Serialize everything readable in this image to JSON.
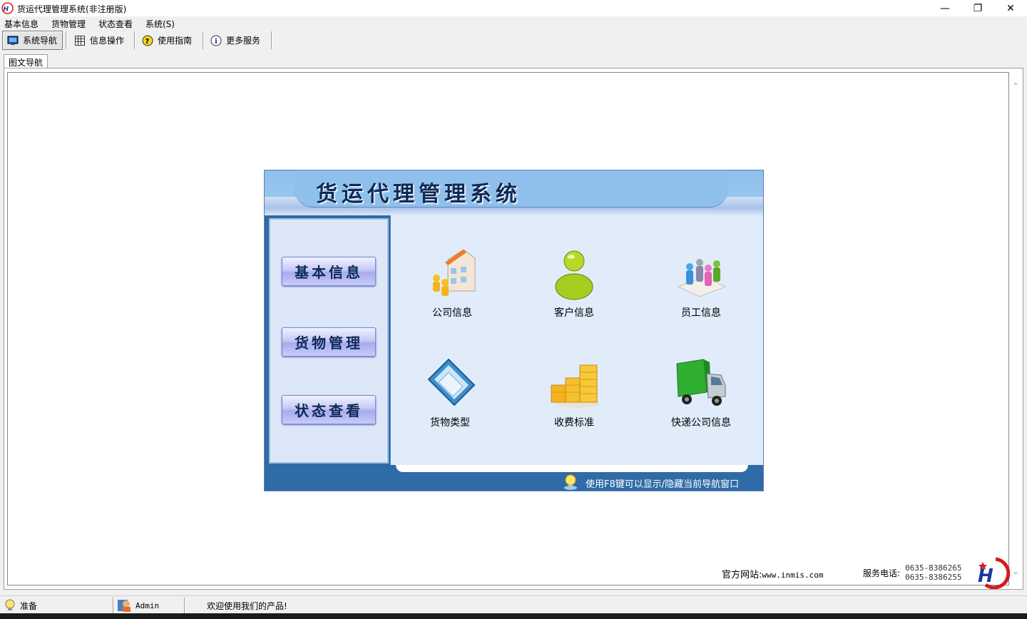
{
  "window": {
    "title": "货运代理管理系统(非注册版)"
  },
  "menu": [
    "基本信息",
    "货物管理",
    "状态查看",
    "系统(S)"
  ],
  "toolbar": [
    {
      "label": "系统导航",
      "icon": "monitor-icon",
      "active": true
    },
    {
      "label": "信息操作",
      "icon": "grid-icon",
      "active": false
    },
    {
      "label": "使用指南",
      "icon": "help-icon",
      "active": false
    },
    {
      "label": "更多服务",
      "icon": "info-icon",
      "active": false
    }
  ],
  "tab": {
    "label": "图文导航"
  },
  "panel": {
    "title": "货运代理管理系统",
    "nav": [
      "基本信息",
      "货物管理",
      "状态查看"
    ],
    "tiles": [
      {
        "label": "公司信息",
        "icon": "company-building-icon"
      },
      {
        "label": "客户信息",
        "icon": "customer-person-icon"
      },
      {
        "label": "员工信息",
        "icon": "staff-group-icon"
      },
      {
        "label": "货物类型",
        "icon": "cargo-type-icon"
      },
      {
        "label": "收费标准",
        "icon": "gold-coins-icon"
      },
      {
        "label": "快递公司信息",
        "icon": "delivery-truck-icon"
      }
    ],
    "tip": "使用F8键可以显示/隐藏当前导航窗口"
  },
  "footer": {
    "site_label": "官方网站:",
    "site_url": "www.inmis.com",
    "phone_label": "服务电话:",
    "phones": [
      "0635-8386265",
      "0635-8386255"
    ]
  },
  "status": {
    "state": "准备",
    "user": "Admin",
    "message": "欢迎使用我们的产品!"
  },
  "colors": {
    "panel_blue": "#2f6ba6",
    "header_blue": "#8fc0ec",
    "grid_bg": "#e1ecfb"
  }
}
